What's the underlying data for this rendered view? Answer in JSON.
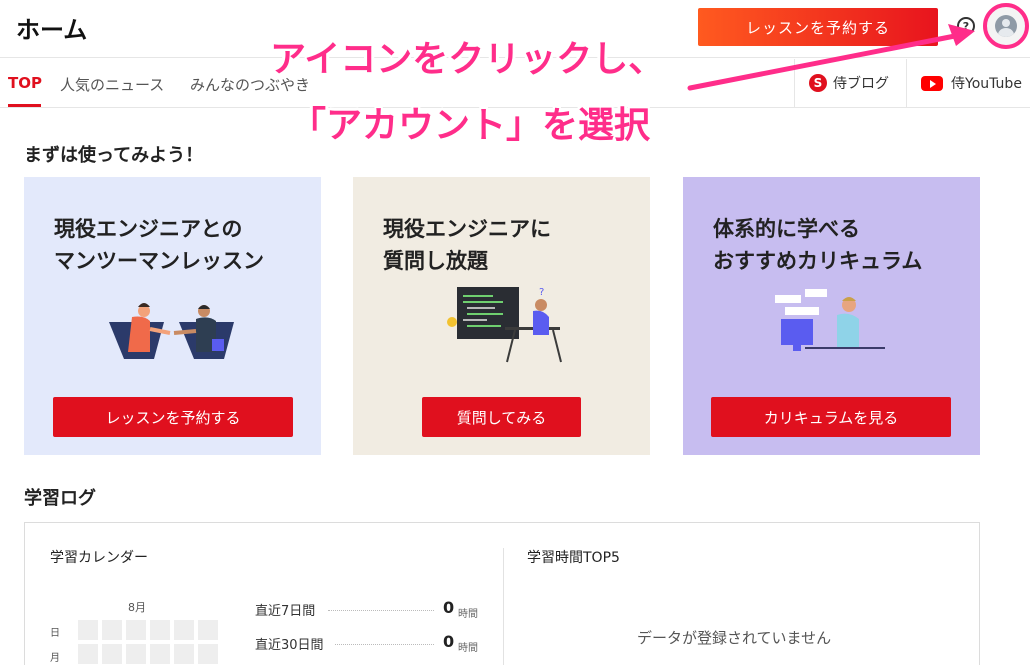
{
  "header": {
    "title": "ホーム",
    "reserve_button": "レッスンを予約する",
    "help_icon": "?",
    "avatar_icon": "avatar-icon"
  },
  "tabs": [
    {
      "label": "TOP",
      "active": true
    },
    {
      "label": "人気のニュース",
      "active": false
    },
    {
      "label": "みんなのつぶやき",
      "active": false
    }
  ],
  "external_links": [
    {
      "label": "侍ブログ",
      "icon": "blog-icon"
    },
    {
      "label": "侍YouTube",
      "icon": "youtube-icon"
    }
  ],
  "annotation": {
    "line1": "アイコンをクリックし、",
    "line2": "「アカウント」を選択",
    "color": "#ff2d8a"
  },
  "intro": {
    "heading": "まずは使ってみよう！",
    "cards": [
      {
        "title_line1": "現役エンジニアとの",
        "title_line2": "マンツーマンレッスン",
        "button": "レッスンを予約する",
        "bg": "#e3e9fb"
      },
      {
        "title_line1": "現役エンジニアに",
        "title_line2": "質問し放題",
        "button": "質問してみる",
        "bg": "#f1ece2"
      },
      {
        "title_line1": "体系的に学べる",
        "title_line2": "おすすめカリキュラム",
        "button": "カリキュラムを見る",
        "bg": "#c7bdf0"
      }
    ]
  },
  "log": {
    "heading": "学習ログ",
    "calendar": {
      "title": "学習カレンダー",
      "month": "8月",
      "days": [
        "日",
        "月"
      ]
    },
    "stats": [
      {
        "label": "直近7日間",
        "value": "0",
        "unit": "時間"
      },
      {
        "label": "直近30日間",
        "value": "0",
        "unit": "時間"
      }
    ],
    "top5": {
      "title": "学習時間TOP5",
      "empty_message": "データが登録されていません"
    }
  },
  "colors": {
    "brand_red": "#e0101e",
    "annotation_pink": "#ff2d8a"
  }
}
